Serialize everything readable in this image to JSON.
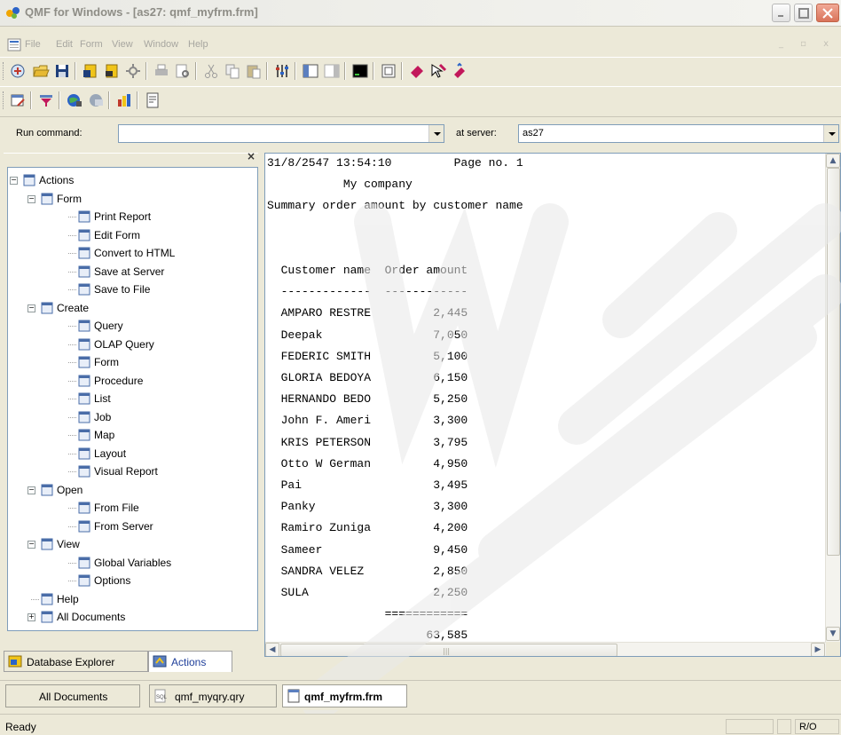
{
  "window": {
    "title": "QMF for Windows - [as27: qmf_myfrm.frm]"
  },
  "menu": {
    "items": [
      "File",
      "Edit",
      "Form",
      "View",
      "Window",
      "Help"
    ]
  },
  "toolbar1": {
    "icons": [
      "wizard-icon",
      "open-folder-icon",
      "save-icon",
      "save-at-server-icon",
      "open-from-server-icon",
      "settings-icon",
      "print-icon",
      "print-preview-icon",
      "cut-icon",
      "copy-icon",
      "paste-icon",
      "options-icon",
      "layout-a-icon",
      "layout-b-icon",
      "command-prompt-icon",
      "maximize-pane-icon",
      "eraser-icon",
      "help-arrow-icon",
      "help-book-icon"
    ]
  },
  "toolbar2": {
    "icons": [
      "edit-form-icon",
      "funnel-icon",
      "convert-html-icon",
      "globe-icon",
      "chart-icon",
      "print-report-icon"
    ]
  },
  "runbar": {
    "run_label": "Run command:",
    "run_value": "",
    "server_label": "at server:",
    "server_value": "as27"
  },
  "tree": {
    "nodes": [
      {
        "label": "Actions",
        "icon": "actions-icon",
        "level": 0,
        "expander": "−"
      },
      {
        "label": "Form",
        "icon": "form-icon",
        "level": 1,
        "expander": "−"
      },
      {
        "label": "Print Report",
        "icon": "print-report-icon",
        "level": 2
      },
      {
        "label": "Edit Form",
        "icon": "edit-form-icon",
        "level": 2
      },
      {
        "label": "Convert to HTML",
        "icon": "convert-html-icon",
        "level": 2
      },
      {
        "label": "Save at Server",
        "icon": "save-at-server-icon",
        "level": 2
      },
      {
        "label": "Save to File",
        "icon": "save-icon",
        "level": 2
      },
      {
        "label": "Create",
        "icon": "create-icon",
        "level": 1,
        "expander": "−"
      },
      {
        "label": "Query",
        "icon": "query-icon",
        "level": 2
      },
      {
        "label": "OLAP Query",
        "icon": "olap-query-icon",
        "level": 2
      },
      {
        "label": "Form",
        "icon": "form-icon",
        "level": 2
      },
      {
        "label": "Procedure",
        "icon": "procedure-icon",
        "level": 2
      },
      {
        "label": "List",
        "icon": "list-icon",
        "level": 2
      },
      {
        "label": "Job",
        "icon": "job-icon",
        "level": 2
      },
      {
        "label": "Map",
        "icon": "map-icon",
        "level": 2
      },
      {
        "label": "Layout",
        "icon": "layout-icon",
        "level": 2
      },
      {
        "label": "Visual Report",
        "icon": "visual-report-icon",
        "level": 2
      },
      {
        "label": "Open",
        "icon": "open-folder-icon",
        "level": 1,
        "expander": "−"
      },
      {
        "label": "From File",
        "icon": "open-folder-icon",
        "level": 2
      },
      {
        "label": "From Server",
        "icon": "open-from-server-icon",
        "level": 2
      },
      {
        "label": "View",
        "icon": "view-icon",
        "level": 1,
        "expander": "−"
      },
      {
        "label": "Global Variables",
        "icon": "global-variables-icon",
        "level": 2
      },
      {
        "label": "Options",
        "icon": "options-icon",
        "level": 2
      },
      {
        "label": "Help",
        "icon": "help-icon",
        "level": 1
      },
      {
        "label": "All Documents",
        "icon": "all-documents-icon",
        "level": 1,
        "expander": "+"
      }
    ]
  },
  "left_tabs": [
    {
      "label": "Database Explorer",
      "icon": "database-explorer-icon",
      "active": false
    },
    {
      "label": "Actions",
      "icon": "actions-icon",
      "active": true
    }
  ],
  "report": {
    "lines": [
      "31/8/2547 13:54:10         Page no. 1",
      "           My company",
      "Summary order amount by customer name",
      "",
      "",
      "  Customer name  Order amount",
      "  -------------  ------------",
      "  AMPARO RESTRE         2,445",
      "  Deepak                7,050",
      "  FEDERIC SMITH         5,100",
      "  GLORIA BEDOYA         6,150",
      "  HERNANDO BEDO         5,250",
      "  John F. Ameri         3,300",
      "  KRIS PETERSON         3,795",
      "  Otto W German         4,950",
      "  Pai                   3,495",
      "  Panky                 3,300",
      "  Ramiro Zuniga         4,200",
      "  Sameer                9,450",
      "  SANDRA VELEZ          2,850",
      "  SULA                  2,250",
      "                 ============",
      "                       63,585"
    ]
  },
  "doc_tabs": [
    {
      "label": "All Documents",
      "icon": "",
      "active": false
    },
    {
      "label": "qmf_myqry.qry",
      "icon": "query-doc-icon",
      "active": false
    },
    {
      "label": "qmf_myfrm.frm",
      "icon": "form-doc-icon",
      "active": true
    }
  ],
  "status": {
    "text": "Ready",
    "mode": "R/O"
  },
  "colors": {
    "chrome": "#ece9d8",
    "border_blue": "#7f9db9",
    "close_red": "#d9735a"
  }
}
